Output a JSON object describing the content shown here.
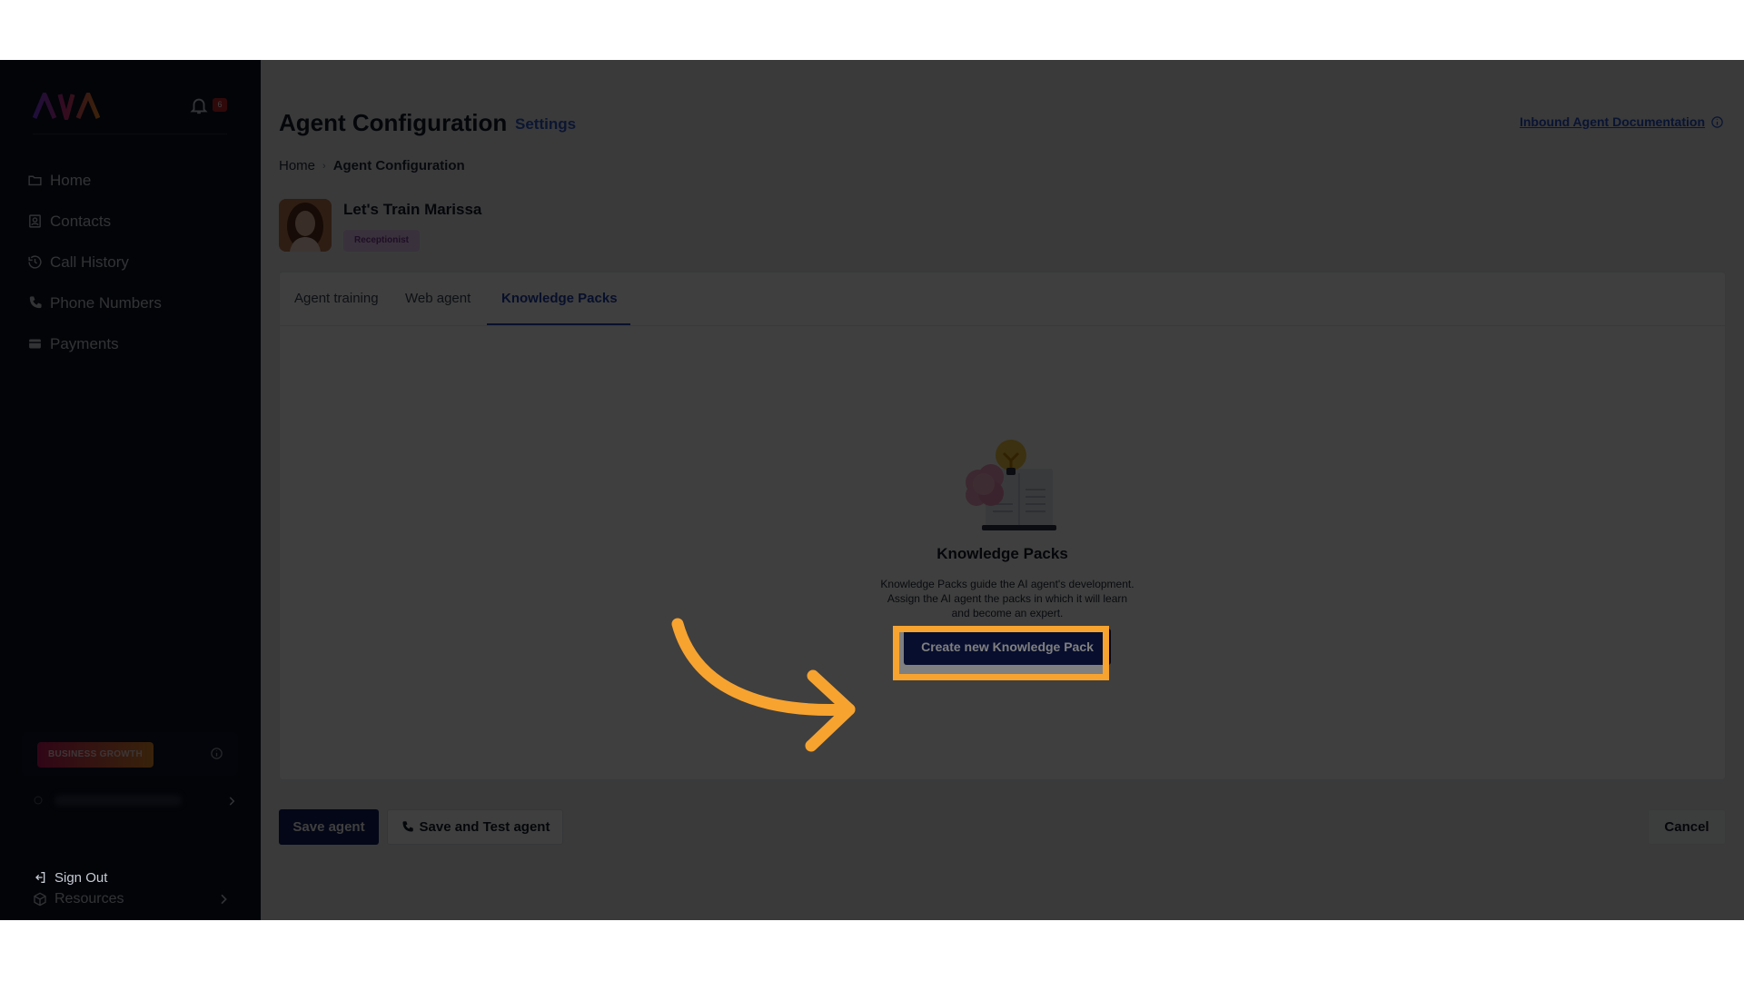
{
  "app": {
    "logo_text": "AVA",
    "notifications_count": "6"
  },
  "sidebar": {
    "nav": [
      {
        "label": "Home",
        "icon": "folder-icon"
      },
      {
        "label": "Contacts",
        "icon": "contacts-icon"
      },
      {
        "label": "Call History",
        "icon": "history-icon"
      },
      {
        "label": "Phone Numbers",
        "icon": "phone-icon"
      },
      {
        "label": "Payments",
        "icon": "card-icon"
      }
    ],
    "plan_label": "BUSINESS GROWTH",
    "resources_label": "Resources",
    "sign_out_label": "Sign Out"
  },
  "header": {
    "title": "Agent Configuration",
    "settings_label": "Settings",
    "doc_link": "Inbound Agent Documentation"
  },
  "breadcrumb": {
    "home": "Home",
    "current": "Agent Configuration"
  },
  "agent": {
    "name": "Let's Train Marissa",
    "role": "Receptionist"
  },
  "tabs": [
    {
      "label": "Agent training",
      "active": false
    },
    {
      "label": "Web agent",
      "active": false
    },
    {
      "label": "Knowledge Packs",
      "active": true
    }
  ],
  "empty_state": {
    "title": "Knowledge Packs",
    "description": "Knowledge Packs guide the AI agent's development. Assign the AI agent the packs in which it will learn and become an expert.",
    "cta": "Create new Knowledge Pack"
  },
  "footer": {
    "save_label": "Save agent",
    "save_test_label": "Save and Test agent",
    "cancel_label": "Cancel"
  },
  "colors": {
    "primary": "#0f1d5c",
    "highlight": "#f7a330",
    "sidebar_bg": "#0b1020"
  }
}
